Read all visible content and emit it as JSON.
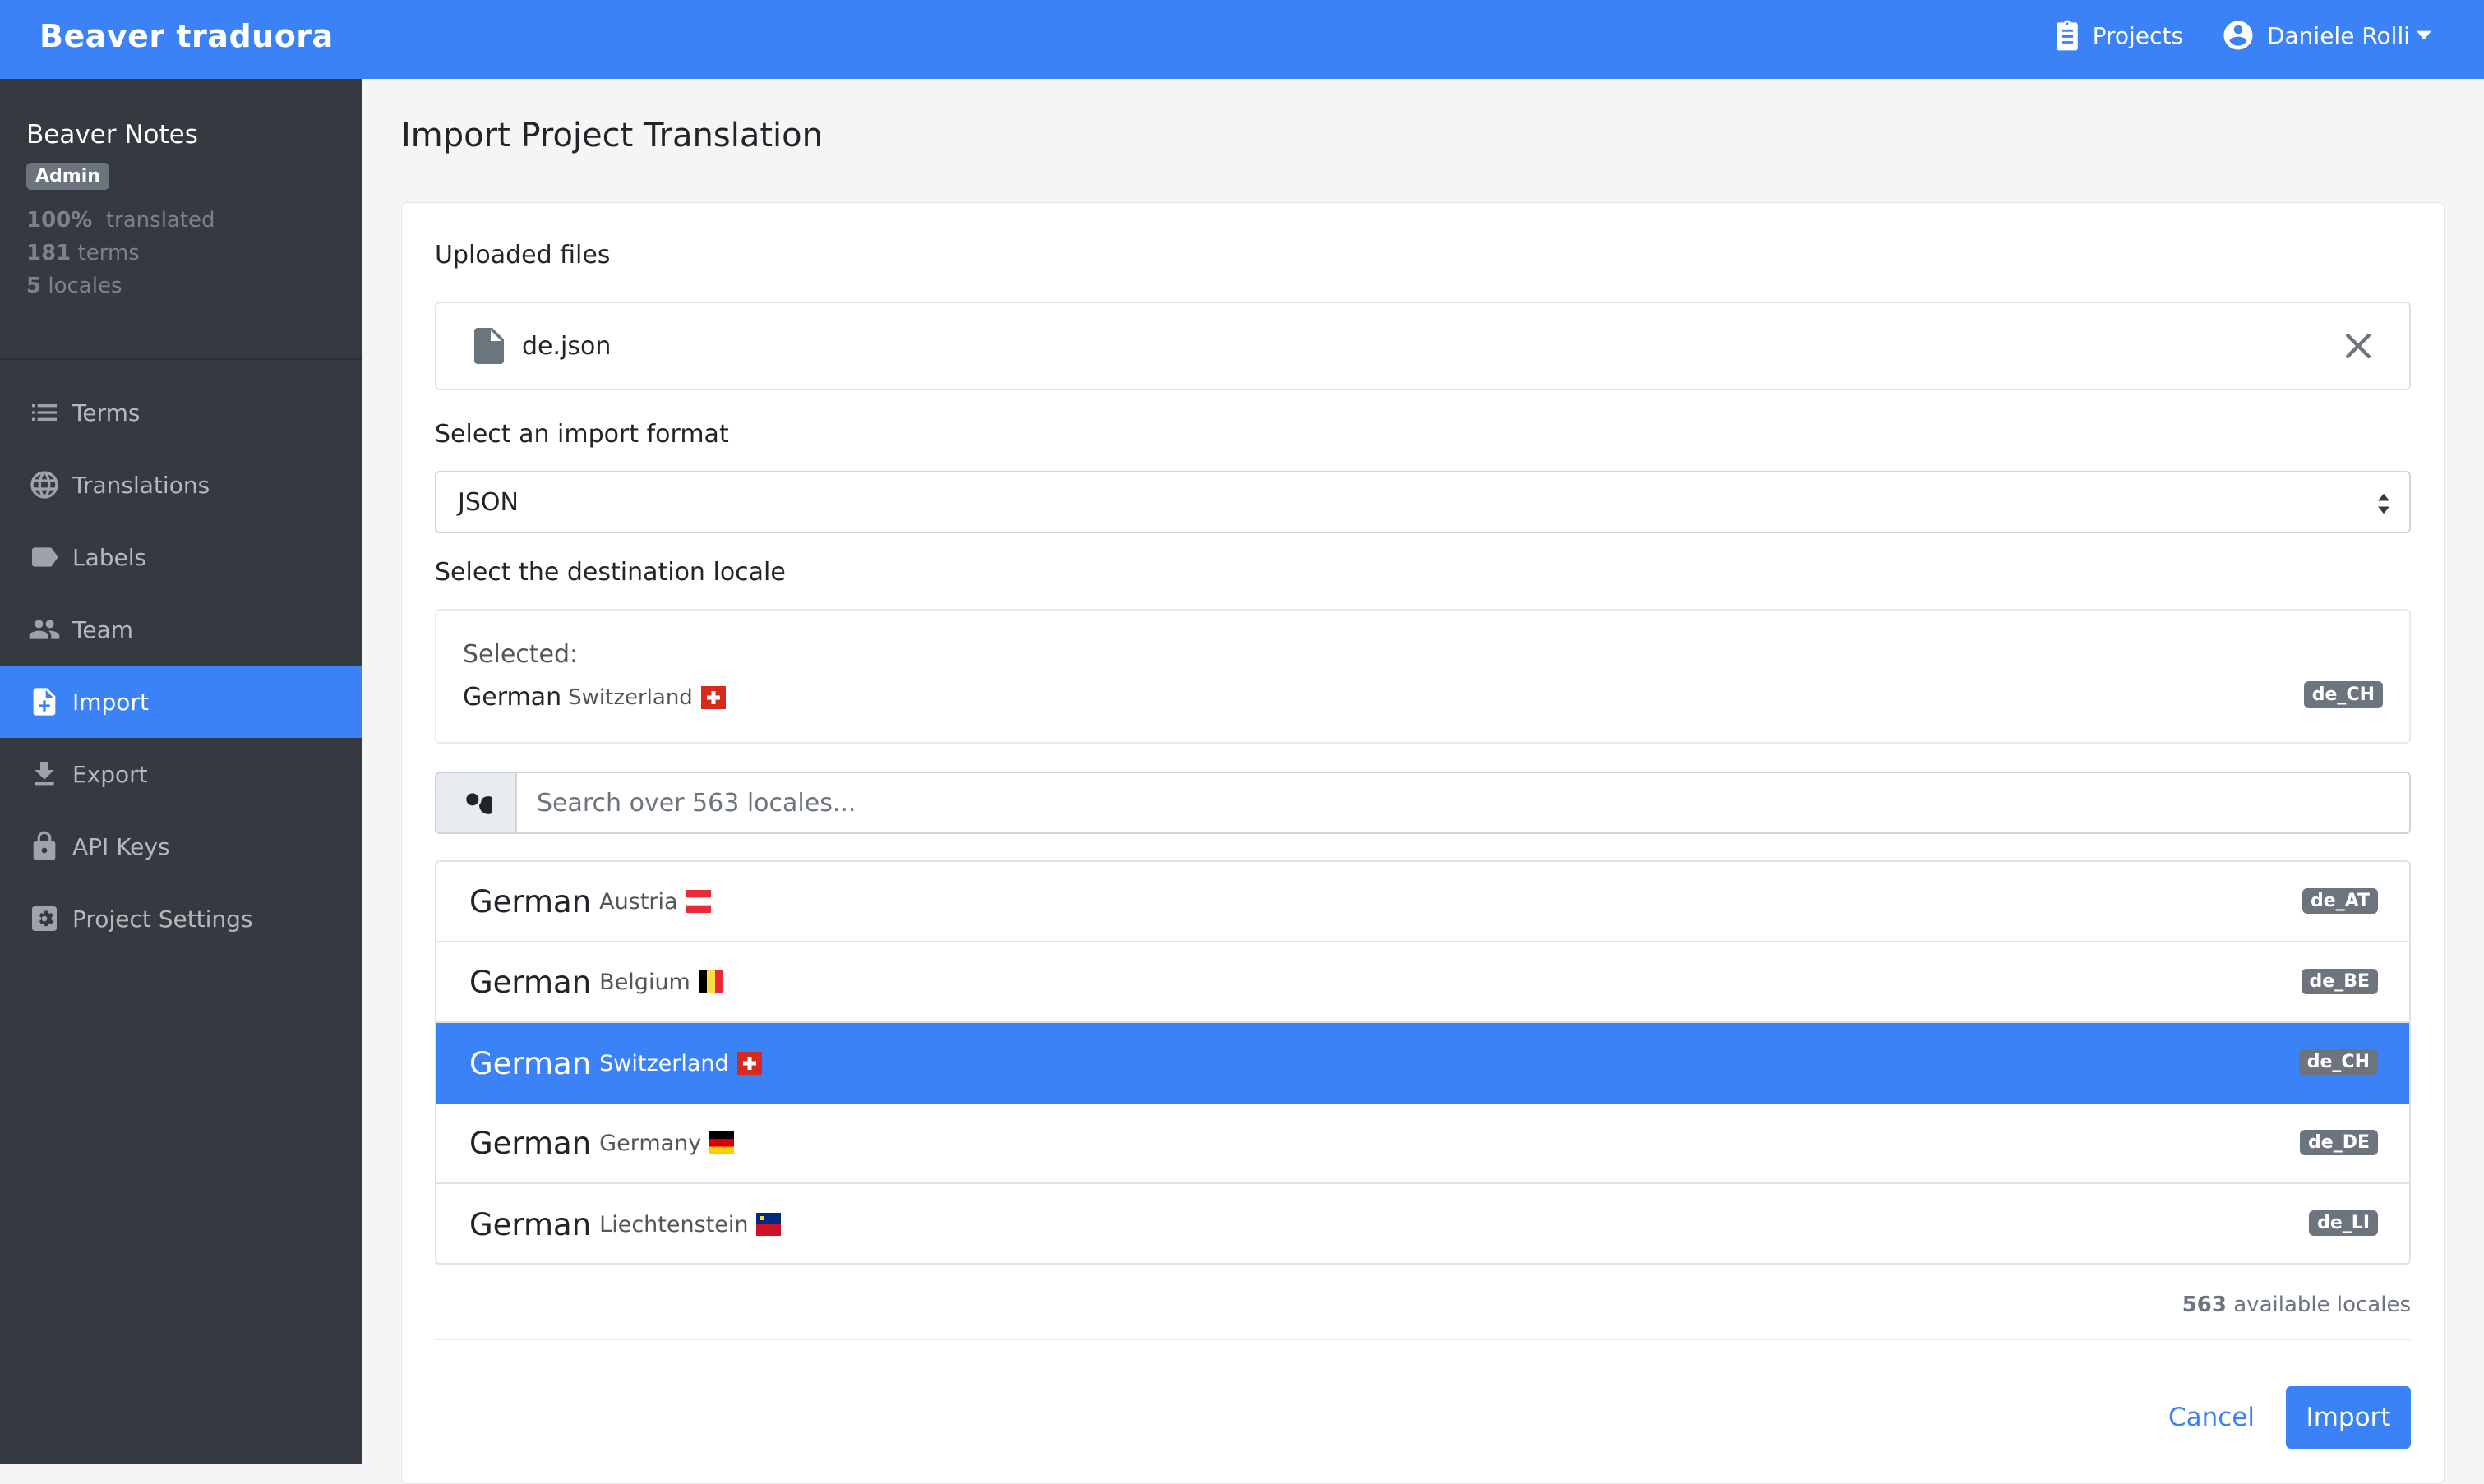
{
  "header": {
    "brand": "Beaver traduora",
    "projects_label": "Projects",
    "user_name": "Daniele Rolli"
  },
  "sidebar": {
    "project_name": "Beaver Notes",
    "role_badge": "Admin",
    "stats": {
      "translated_value": "100%",
      "translated_label": "translated",
      "terms_value": "181",
      "terms_label": "terms",
      "locales_value": "5",
      "locales_label": "locales"
    },
    "items": [
      {
        "label": "Terms",
        "icon": "list-icon"
      },
      {
        "label": "Translations",
        "icon": "globe-icon"
      },
      {
        "label": "Labels",
        "icon": "tag-icon"
      },
      {
        "label": "Team",
        "icon": "people-icon"
      },
      {
        "label": "Import",
        "icon": "file-plus-icon",
        "active": true
      },
      {
        "label": "Export",
        "icon": "download-icon"
      },
      {
        "label": "API Keys",
        "icon": "lock-icon"
      },
      {
        "label": "Project Settings",
        "icon": "settings-icon"
      }
    ]
  },
  "main": {
    "page_title": "Import Project Translation",
    "uploaded_files_label": "Uploaded files",
    "file_name": "de.json",
    "import_format_label": "Select an import format",
    "import_format_value": "JSON",
    "destination_label": "Select the destination locale",
    "selected_label": "Selected:",
    "selected_language": "German",
    "selected_region": "Switzerland",
    "selected_code": "de_CH",
    "search_placeholder": "Search over 563 locales...",
    "locales": [
      {
        "language": "German",
        "region": "Austria",
        "code": "de_AT",
        "flag": "at"
      },
      {
        "language": "German",
        "region": "Belgium",
        "code": "de_BE",
        "flag": "be"
      },
      {
        "language": "German",
        "region": "Switzerland",
        "code": "de_CH",
        "flag": "ch",
        "active": true
      },
      {
        "language": "German",
        "region": "Germany",
        "code": "de_DE",
        "flag": "de"
      },
      {
        "language": "German",
        "region": "Liechtenstein",
        "code": "de_LI",
        "flag": "li"
      }
    ],
    "available_count": "563",
    "available_label": "available locales",
    "cancel_label": "Cancel",
    "import_label": "Import"
  },
  "colors": {
    "primary": "#3b82f6",
    "sidebar_bg": "#343a40",
    "badge_bg": "#6c757d"
  }
}
